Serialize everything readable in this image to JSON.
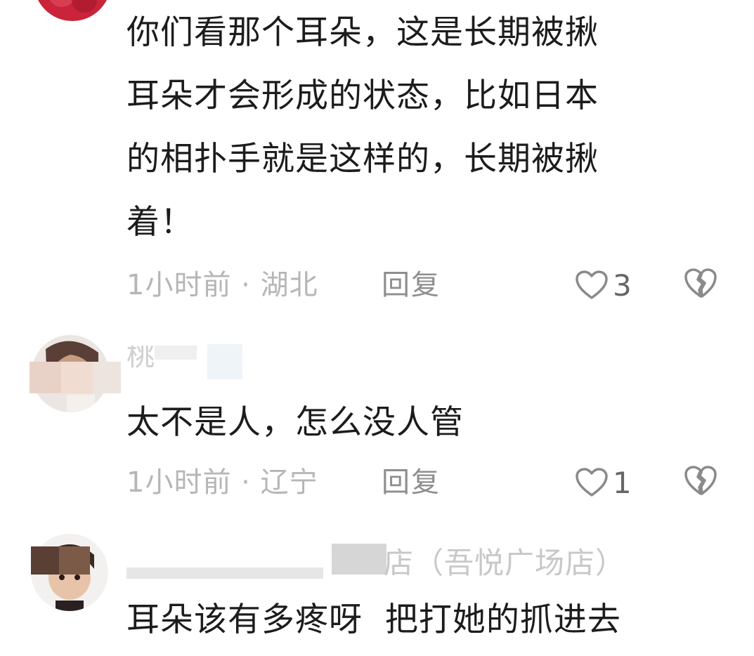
{
  "comments": [
    {
      "text": "你们看那个耳朵，这是长期被揪\n耳朵才会形成的状态，比如日本\n的相扑手就是这样的，长期被揪\n着！",
      "time": "1小时前",
      "location": "湖北",
      "meta_sep": " · ",
      "reply": "回复",
      "likes": "3"
    },
    {
      "username": "桃",
      "text": "太不是人，怎么没人管",
      "time": "1小时前",
      "location": "辽宁",
      "meta_sep": " · ",
      "reply": "回复",
      "likes": "1"
    },
    {
      "username_suffix": "店（吾悦广场店）",
      "text": "耳朵该有多疼呀  把打她的抓进去"
    }
  ],
  "colors": {
    "text": "#1c1c1c",
    "meta": "#b6b6b6",
    "icon": "#8a8a8a"
  },
  "icons": {
    "like": "heart-outline-icon",
    "dislike": "broken-heart-icon"
  }
}
